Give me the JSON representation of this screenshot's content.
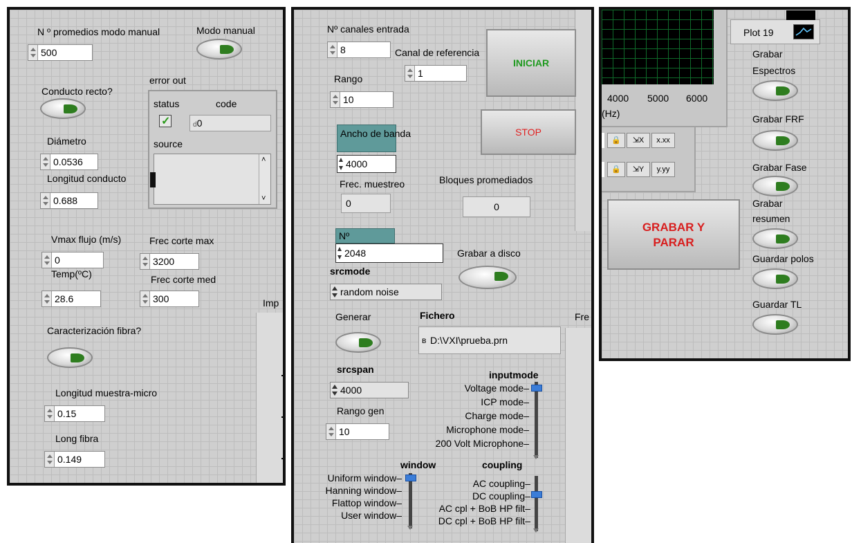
{
  "panel1": {
    "prom_label": "N º promedios modo manual",
    "prom_value": "500",
    "modo_manual_label": "Modo manual",
    "conducto_label": "Conducto recto?",
    "error_out": {
      "title": "error out",
      "status_label": "status",
      "code_label": "code",
      "code_value": "0",
      "source_label": "source",
      "status_ok": true
    },
    "diametro_label": "Diámetro",
    "diametro_value": "0.0536",
    "longitud_label": "Longitud conducto",
    "longitud_value": "0.688",
    "vmax_label": "Vmax flujo (m/s)",
    "vmax_value": "0",
    "frec_max_label": "Frec corte max",
    "frec_max_value": "3200",
    "temp_label": "Temp(ºC)",
    "temp_value": "28.6",
    "frec_med_label": "Frec corte med",
    "frec_med_value": "300",
    "imp_label": "Imp",
    "caract_label": "Caracterización fibra?",
    "long_muestra_label": "Longitud muestra-micro",
    "long_muestra_value": "0.15",
    "long_fibra_label": "Long fibra",
    "long_fibra_value": "0.149"
  },
  "panel2": {
    "canales_label": "Nº canales entrada",
    "canales_value": "8",
    "canal_ref_label": "Canal de referencia",
    "canal_ref_value": "1",
    "rango_label": "Rango",
    "rango_value": "10",
    "iniciar_label": "INICIAR",
    "iniciar_color": "#1f9a1f",
    "stop_label": "STOP",
    "stop_color": "#e02020",
    "ancho_label": "Ancho de banda",
    "ancho_value": "4000",
    "frec_muestreo_label": "Frec. muestreo",
    "frec_muestreo_value": "0",
    "bloques_label": "Bloques promediados",
    "bloques_value": "0",
    "n_label": "Nº",
    "n_value": "2048",
    "grabar_disco_label": "Grabar a disco",
    "srcmode_label": "srcmode",
    "srcmode_value": "random noise",
    "generar_label": "Generar",
    "fichero_label": "Fichero",
    "fichero_value": "D:\\VXI\\prueba.prn",
    "fre_label": "Fre",
    "srcspan_label": "srcspan",
    "srcspan_value": "4000",
    "inputmode_label": "inputmode",
    "inputmode_options": [
      "Voltage mode",
      "ICP mode",
      "Charge mode",
      "Microphone mode",
      "200 Volt Microphone"
    ],
    "rango_gen_label": "Rango gen",
    "rango_gen_value": "10",
    "window_label": "window",
    "window_options": [
      "Uniform window",
      "Hanning window",
      "Flattop window",
      "User window"
    ],
    "coupling_label": "coupling",
    "coupling_options": [
      "AC coupling",
      "DC coupling",
      "AC cpl + BoB HP filt",
      "DC cpl + BoB HP filt"
    ]
  },
  "panel3": {
    "plot_label": "Plot 19",
    "axis_ticks": [
      "4000",
      "5000",
      "6000"
    ],
    "axis_unit": "(Hz)",
    "palette_x_label": "x.xx",
    "palette_y_label": "y.yy",
    "grabar_parar_line1": "GRABAR Y",
    "grabar_parar_line2": "PARAR",
    "grabar_parar_color": "#d81e1e",
    "grabar_espectros_line1": "Grabar",
    "grabar_espectros_line2": "Espectros",
    "grabar_frf_label": "Grabar FRF",
    "grabar_fase_label": "Grabar Fase",
    "grabar_resumen_line1": "Grabar",
    "grabar_resumen_line2": "resumen",
    "guardar_polos_label": "Guardar polos",
    "guardar_tl_label": "Guardar TL"
  }
}
